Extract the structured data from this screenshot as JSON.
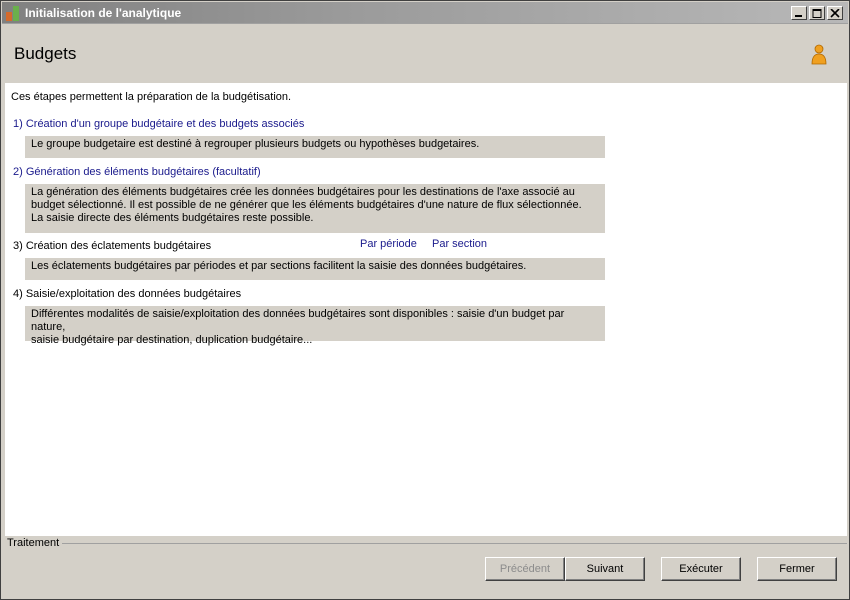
{
  "window": {
    "title": "Initialisation de l'analytique"
  },
  "header": {
    "title": "Budgets",
    "icon": "user-icon"
  },
  "content": {
    "intro": "Ces étapes permettent la préparation de la budgétisation.",
    "steps": [
      {
        "title": "1) Création d'un groupe budgétaire et des budgets associés",
        "description": "Le groupe budgetaire est destiné à regrouper plusieurs budgets ou hypothèses budgetaires."
      },
      {
        "title": "2) Génération des éléments budgétaires (facultatif)",
        "description_lines": [
          "La génération des éléments budgétaires crée les données budgétaires pour les destinations de l'axe associé au",
          "budget sélectionné. Il est possible de ne générer que les éléments budgétaires d'une nature de flux sélectionnée.",
          "La saisie directe des éléments budgétaires reste possible."
        ]
      },
      {
        "title": "3) Création des éclatements budgétaires",
        "links": [
          "Par période",
          "Par section"
        ],
        "description": "Les éclatements budgétaires par périodes et par sections facilitent la saisie des données budgétaires."
      },
      {
        "title": "4) Saisie/exploitation des données budgétaires",
        "description_lines": [
          "Différentes modalités de saisie/exploitation des données budgétaires sont disponibles : saisie d'un budget par nature,",
          "saisie budgétaire par destination, duplication budgétaire..."
        ]
      }
    ]
  },
  "footer": {
    "group_label": "Traitement",
    "buttons": {
      "previous": "Précédent",
      "next": "Suivant",
      "execute": "Exécuter",
      "close": "Fermer"
    }
  },
  "colors": {
    "link": "#1a1a8c",
    "panel": "#d4d0c8",
    "content_bg": "#ffffff"
  }
}
